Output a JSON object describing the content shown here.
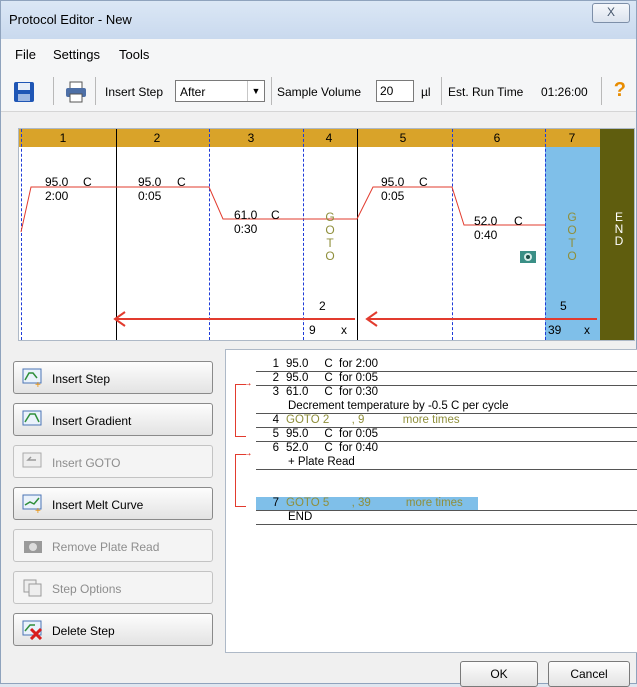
{
  "window": {
    "title": "Protocol Editor - New",
    "close_glyph": "X"
  },
  "menu": {
    "items": [
      "File",
      "Settings",
      "Tools"
    ]
  },
  "toolbar": {
    "insert_step_label": "Insert Step",
    "insert_step_value": "After",
    "sample_volume_label": "Sample Volume",
    "sample_volume_value": "20",
    "sample_volume_unit": "µl",
    "run_time_label": "Est. Run Time",
    "run_time_value": "01:26:00",
    "help_glyph": "?"
  },
  "graph": {
    "steps": [
      "1",
      "2",
      "3",
      "4",
      "5",
      "6",
      "7"
    ],
    "temps": [
      {
        "temp": "95.0",
        "unit": "C",
        "time": "2:00"
      },
      {
        "temp": "95.0",
        "unit": "C",
        "time": "0:05"
      },
      {
        "temp": "61.0",
        "unit": "C",
        "time": "0:30"
      },
      {
        "temp": "95.0",
        "unit": "C",
        "time": "0:05"
      },
      {
        "temp": "52.0",
        "unit": "C",
        "time": "0:40"
      }
    ],
    "goto_letters": [
      "G",
      "O",
      "T",
      "O"
    ],
    "end_letters": [
      "E",
      "N",
      "D"
    ],
    "goto1": {
      "target": "2",
      "repeat": "9",
      "x": "x"
    },
    "goto2": {
      "target": "5",
      "repeat": "39",
      "x": "x"
    }
  },
  "buttons": [
    {
      "label": "Insert Step",
      "enabled": true
    },
    {
      "label": "Insert Gradient",
      "enabled": true
    },
    {
      "label": "Insert GOTO",
      "enabled": false
    },
    {
      "label": "Insert Melt Curve",
      "enabled": true
    },
    {
      "label": "Remove Plate Read",
      "enabled": false
    },
    {
      "label": "Step Options",
      "enabled": false
    },
    {
      "label": "Delete Step",
      "enabled": true
    }
  ],
  "steps_list": [
    {
      "num": "1",
      "text": "95.0     C  for 2:00"
    },
    {
      "num": "2",
      "text": "95.0     C  for 0:05"
    },
    {
      "num": "3",
      "text": "61.0     C  for 0:30"
    },
    {
      "num": "",
      "text": "Decrement temperature by  -0.5       C per cycle"
    },
    {
      "num": "4",
      "text": "GOTO 2       , 9            more times"
    },
    {
      "num": "5",
      "text": "95.0     C  for 0:05"
    },
    {
      "num": "6",
      "text": "52.0     C  for 0:40"
    },
    {
      "num": "",
      "text": "+ Plate Read"
    },
    {
      "num": "7",
      "text": "GOTO 5       , 39           more times"
    },
    {
      "num": "",
      "text": "END"
    }
  ],
  "footer": {
    "ok_label": "OK",
    "cancel_label": "Cancel"
  },
  "colors": {
    "header_gold": "#d9a329",
    "selection_blue": "#7fbfe9",
    "end_olive": "#5f5d0e",
    "arrow_red": "#e23b2e",
    "boundary_blue": "#1f3bd8"
  }
}
